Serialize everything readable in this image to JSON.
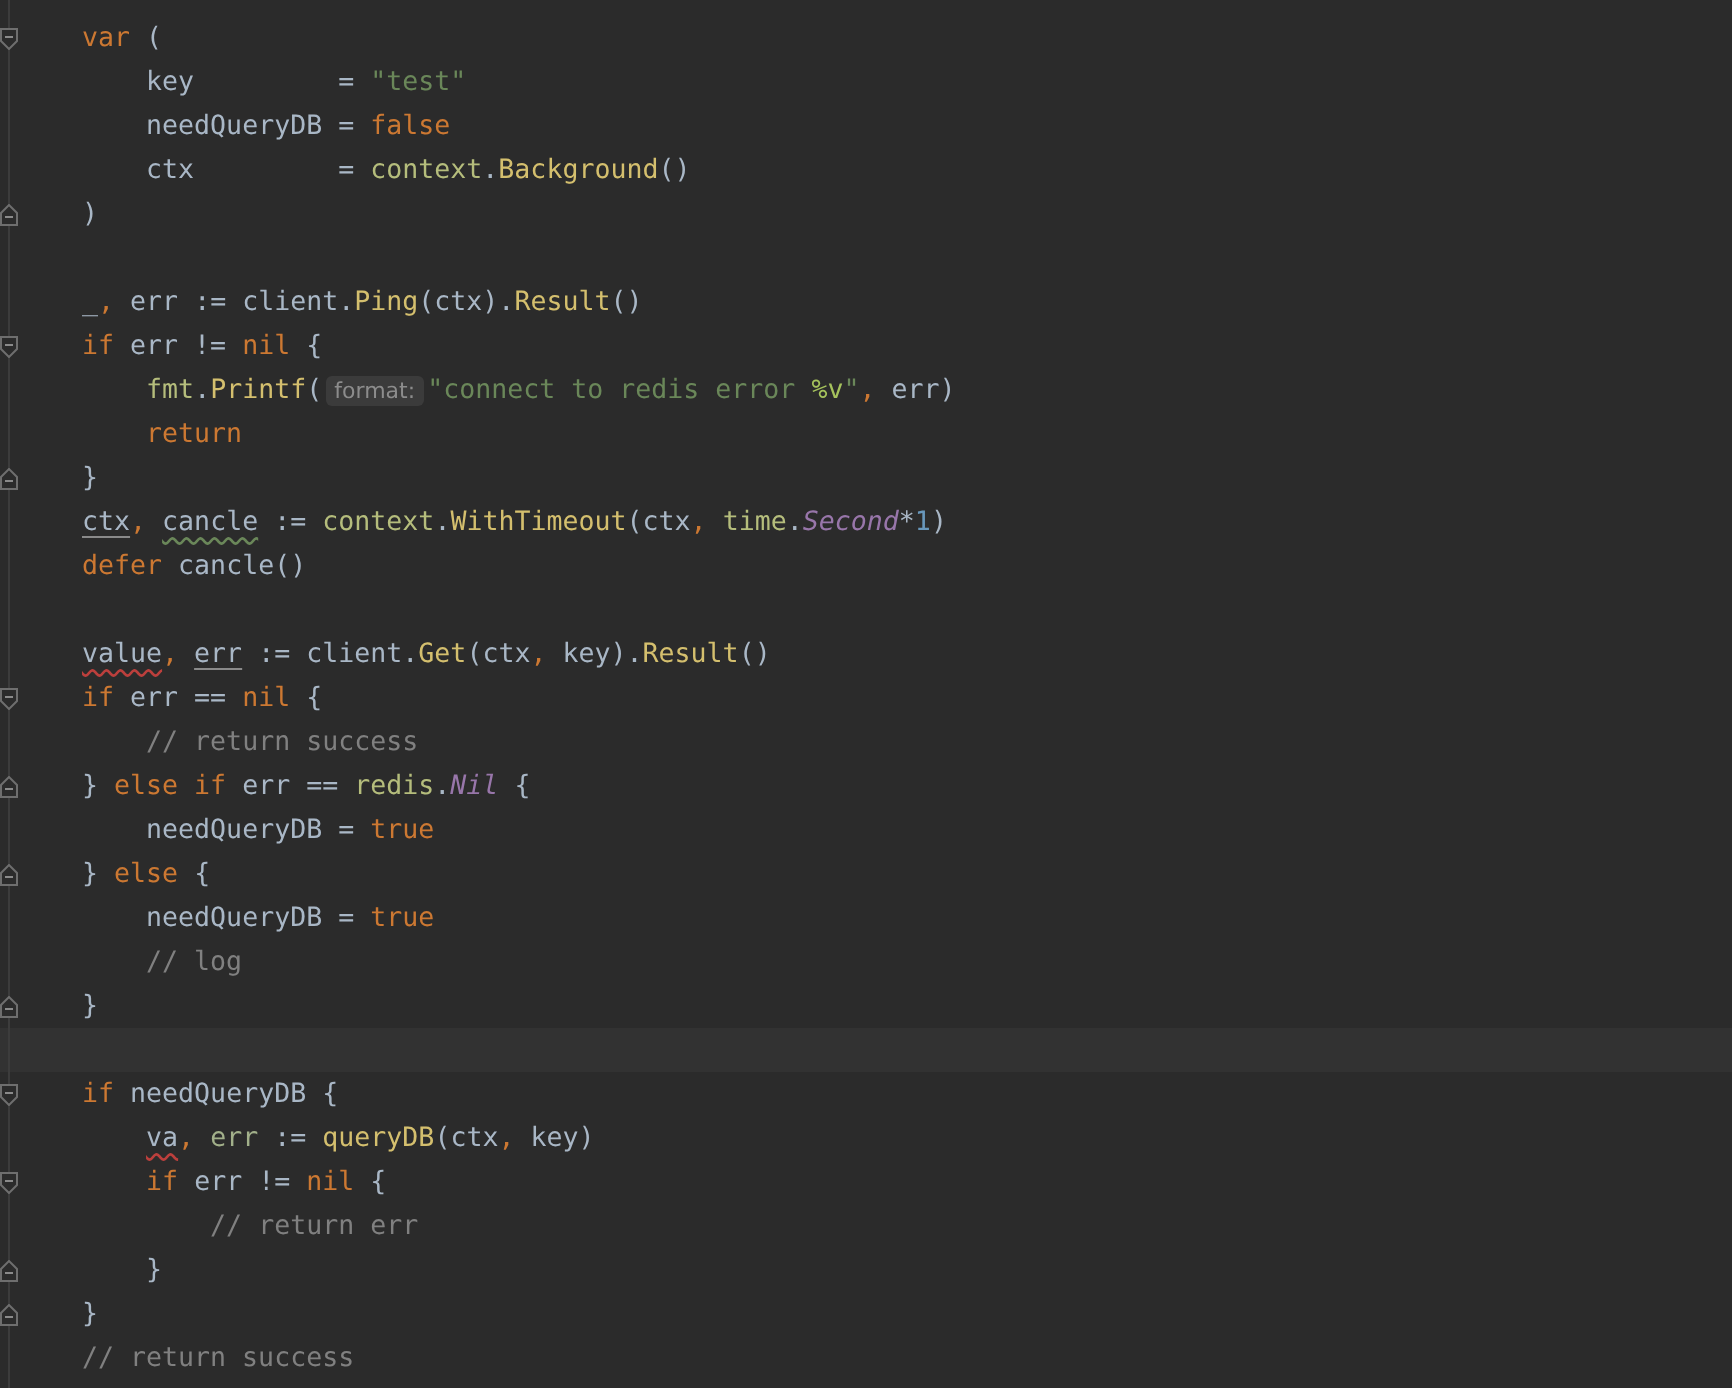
{
  "editor": {
    "lines": [
      {
        "fold_start": true,
        "tokens": [
          {
            "kind": "kw",
            "text": "var"
          },
          {
            "kind": "plain",
            "text": " ("
          }
        ]
      },
      {
        "tokens": [
          {
            "kind": "plain",
            "text": "    key         = "
          },
          {
            "kind": "str",
            "text": "\"test\""
          }
        ]
      },
      {
        "tokens": [
          {
            "kind": "plain",
            "text": "    needQueryDB = "
          },
          {
            "kind": "kw",
            "text": "false"
          }
        ]
      },
      {
        "tokens": [
          {
            "kind": "plain",
            "text": "    ctx         = "
          },
          {
            "kind": "pkg",
            "text": "context"
          },
          {
            "kind": "plain",
            "text": "."
          },
          {
            "kind": "fn",
            "text": "Background"
          },
          {
            "kind": "plain",
            "text": "()"
          }
        ]
      },
      {
        "fold_end": true,
        "tokens": [
          {
            "kind": "plain",
            "text": ")"
          }
        ]
      },
      {
        "blank_before": true,
        "tokens": [
          {
            "kind": "plain",
            "text": "_"
          },
          {
            "kind": "kw",
            "text": ","
          },
          {
            "kind": "plain",
            "text": " err := client."
          },
          {
            "kind": "fn",
            "text": "Ping"
          },
          {
            "kind": "plain",
            "text": "(ctx)."
          },
          {
            "kind": "fn",
            "text": "Result"
          },
          {
            "kind": "plain",
            "text": "()"
          }
        ]
      },
      {
        "fold_start": true,
        "tokens": [
          {
            "kind": "kw",
            "text": "if"
          },
          {
            "kind": "plain",
            "text": " err != "
          },
          {
            "kind": "kw",
            "text": "nil"
          },
          {
            "kind": "plain",
            "text": " {"
          }
        ]
      },
      {
        "tokens": [
          {
            "kind": "pkg",
            "text": "    fmt"
          },
          {
            "kind": "plain",
            "text": "."
          },
          {
            "kind": "fn",
            "text": "Printf"
          },
          {
            "kind": "plain",
            "text": "("
          },
          {
            "kind": "hint",
            "text": "format:"
          },
          {
            "kind": "str",
            "text": "\"connect to redis error "
          },
          {
            "kind": "verb",
            "text": "%v"
          },
          {
            "kind": "str",
            "text": "\""
          },
          {
            "kind": "kw",
            "text": ","
          },
          {
            "kind": "plain",
            "text": " err)"
          }
        ]
      },
      {
        "tokens": [
          {
            "kind": "kw",
            "text": "    return"
          }
        ]
      },
      {
        "fold_end": true,
        "tokens": [
          {
            "kind": "plain",
            "text": "}"
          }
        ]
      },
      {
        "tokens": [
          {
            "kind": "plain",
            "text": "ctx",
            "underlined": true
          },
          {
            "kind": "kw",
            "text": ", "
          },
          {
            "kind": "plain",
            "text": "cancle",
            "typo": true
          },
          {
            "kind": "plain",
            "text": " := "
          },
          {
            "kind": "pkg",
            "text": "context"
          },
          {
            "kind": "plain",
            "text": "."
          },
          {
            "kind": "fn",
            "text": "WithTimeout"
          },
          {
            "kind": "plain",
            "text": "(ctx"
          },
          {
            "kind": "kw",
            "text": ", "
          },
          {
            "kind": "pkg",
            "text": "time"
          },
          {
            "kind": "plain",
            "text": "."
          },
          {
            "kind": "const",
            "text": "Second"
          },
          {
            "kind": "plain",
            "text": "*"
          },
          {
            "kind": "num",
            "text": "1"
          },
          {
            "kind": "plain",
            "text": ")"
          }
        ]
      },
      {
        "tokens": [
          {
            "kind": "kw",
            "text": "defer"
          },
          {
            "kind": "plain",
            "text": " cancle()"
          }
        ]
      },
      {
        "blank_before": true,
        "tokens": [
          {
            "kind": "plain",
            "text": "value",
            "error": true
          },
          {
            "kind": "kw",
            "text": ", "
          },
          {
            "kind": "plain",
            "text": "err",
            "underlined": true
          },
          {
            "kind": "plain",
            "text": " := client."
          },
          {
            "kind": "fn",
            "text": "Get"
          },
          {
            "kind": "plain",
            "text": "(ctx"
          },
          {
            "kind": "kw",
            "text": ","
          },
          {
            "kind": "plain",
            "text": " key)."
          },
          {
            "kind": "fn",
            "text": "Result"
          },
          {
            "kind": "plain",
            "text": "()"
          }
        ]
      },
      {
        "fold_start": true,
        "tokens": [
          {
            "kind": "kw",
            "text": "if"
          },
          {
            "kind": "plain",
            "text": " err == "
          },
          {
            "kind": "kw",
            "text": "nil"
          },
          {
            "kind": "plain",
            "text": " {"
          }
        ]
      },
      {
        "tokens": [
          {
            "kind": "comment",
            "text": "    // return success"
          }
        ]
      },
      {
        "fold_end": true,
        "tokens": [
          {
            "kind": "plain",
            "text": "} "
          },
          {
            "kind": "kw",
            "text": "else if"
          },
          {
            "kind": "plain",
            "text": " err == "
          },
          {
            "kind": "pkg",
            "text": "redis"
          },
          {
            "kind": "plain",
            "text": "."
          },
          {
            "kind": "const",
            "text": "Nil"
          },
          {
            "kind": "plain",
            "text": " {"
          }
        ]
      },
      {
        "tokens": [
          {
            "kind": "plain",
            "text": "    needQueryDB = "
          },
          {
            "kind": "kw",
            "text": "true"
          }
        ]
      },
      {
        "fold_end": true,
        "tokens": [
          {
            "kind": "plain",
            "text": "} "
          },
          {
            "kind": "kw",
            "text": "else"
          },
          {
            "kind": "plain",
            "text": " {"
          }
        ]
      },
      {
        "tokens": [
          {
            "kind": "plain",
            "text": "    needQueryDB = "
          },
          {
            "kind": "kw",
            "text": "true"
          }
        ]
      },
      {
        "tokens": [
          {
            "kind": "comment",
            "text": "    // log"
          }
        ]
      },
      {
        "fold_end": true,
        "tokens": [
          {
            "kind": "plain",
            "text": "}"
          }
        ]
      },
      {
        "current": true
      },
      {
        "fold_start": true,
        "tokens": [
          {
            "kind": "kw",
            "text": "if"
          },
          {
            "kind": "plain",
            "text": " needQueryDB {"
          }
        ]
      },
      {
        "tokens": [
          {
            "kind": "plain",
            "text": "    va",
            "error": true
          },
          {
            "kind": "kw",
            "text": ", "
          },
          {
            "kind": "local",
            "text": "err"
          },
          {
            "kind": "plain",
            "text": " := "
          },
          {
            "kind": "fn",
            "text": "queryDB"
          },
          {
            "kind": "plain",
            "text": "(ctx"
          },
          {
            "kind": "kw",
            "text": ","
          },
          {
            "kind": "plain",
            "text": " key)"
          }
        ]
      },
      {
        "fold_start": true,
        "tokens": [
          {
            "kind": "kw",
            "text": "    if"
          },
          {
            "kind": "plain",
            "text": " err != "
          },
          {
            "kind": "kw",
            "text": "nil"
          },
          {
            "kind": "plain",
            "text": " {"
          }
        ]
      },
      {
        "tokens": [
          {
            "kind": "comment",
            "text": "        // return err"
          }
        ]
      },
      {
        "fold_end": true,
        "tokens": [
          {
            "kind": "plain",
            "text": "    }"
          }
        ]
      },
      {
        "fold_end": true,
        "tokens": [
          {
            "kind": "plain",
            "text": "}"
          }
        ]
      },
      {
        "tokens": [
          {
            "kind": "comment",
            "text": "// return success"
          }
        ]
      }
    ]
  }
}
